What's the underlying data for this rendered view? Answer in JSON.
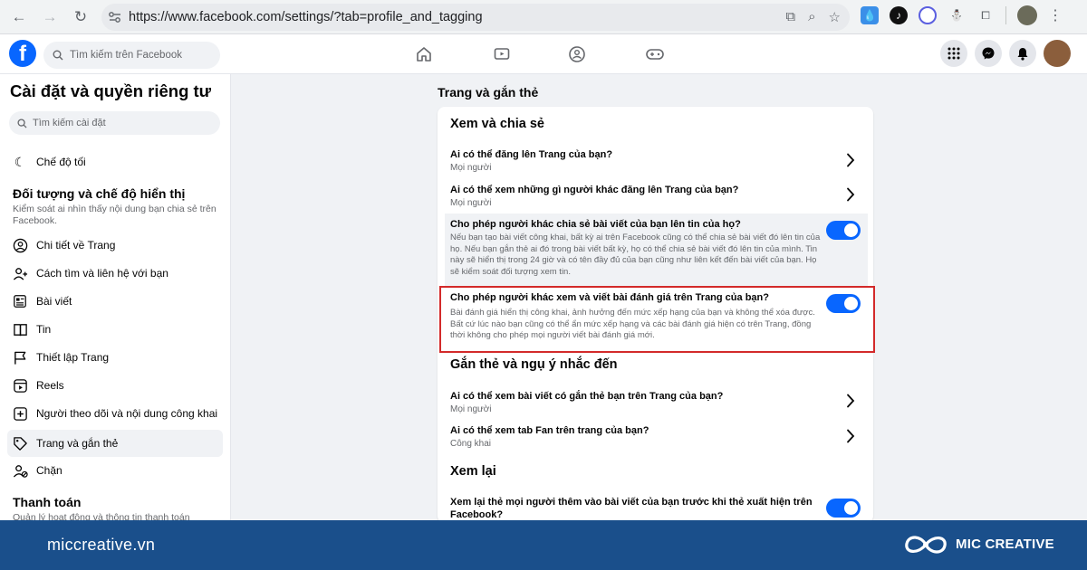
{
  "browser": {
    "url": "https://www.facebook.com/settings/?tab=profile_and_tagging"
  },
  "fb_header": {
    "logo_letter": "f",
    "search_placeholder": "Tìm kiếm trên Facebook"
  },
  "sidebar": {
    "title": "Cài đặt và quyền riêng tư",
    "search_placeholder": "Tìm kiếm cài đặt",
    "dark_mode_label": "Chế độ tối",
    "section_audience": {
      "heading": "Đối tượng và chế độ hiển thị",
      "description": "Kiểm soát ai nhìn thấy nội dung bạn chia sẻ trên Facebook."
    },
    "items": [
      {
        "label": "Chi tiết về Trang",
        "icon": "user-circle-icon"
      },
      {
        "label": "Cách tìm và liên hệ với bạn",
        "icon": "user-plus-icon"
      },
      {
        "label": "Bài viết",
        "icon": "post-icon"
      },
      {
        "label": "Tin",
        "icon": "book-open-icon"
      },
      {
        "label": "Thiết lập Trang",
        "icon": "flag-icon"
      },
      {
        "label": "Reels",
        "icon": "reels-icon"
      },
      {
        "label": "Người theo dõi và nội dung công khai",
        "icon": "plus-square-icon"
      },
      {
        "label": "Trang và gắn thẻ",
        "icon": "tag-icon",
        "active": true
      },
      {
        "label": "Chặn",
        "icon": "block-user-icon"
      }
    ],
    "section_payment": {
      "heading": "Thanh toán",
      "description": "Quản lý hoạt động và thông tin thanh toán"
    }
  },
  "main": {
    "title": "Trang và gắn thẻ",
    "sections": [
      {
        "heading": "Xem và chia sẻ",
        "rows": [
          {
            "title": "Ai có thể đăng lên Trang của bạn?",
            "value": "Mọi người",
            "control": "chevron"
          },
          {
            "title": "Ai có thể xem những gì người khác đăng lên Trang của bạn?",
            "value": "Mọi người",
            "control": "chevron"
          },
          {
            "title": "Cho phép người khác chia sẻ bài viết của bạn lên tin của họ?",
            "description": "Nếu bạn tạo bài viết công khai, bất kỳ ai trên Facebook cũng có thể chia sẻ bài viết đó lên tin của họ. Nếu bạn gắn thẻ ai đó trong bài viết bất kỳ, họ có thể chia sẻ bài viết đó lên tin của mình. Tin này sẽ hiển thị trong 24 giờ và có tên đầy đủ của bạn cũng như liên kết đến bài viết của bạn. Họ sẽ kiểm soát đối tượng xem tin.",
            "control": "toggle",
            "on": true
          },
          {
            "title": "Cho phép người khác xem và viết bài đánh giá trên Trang của bạn?",
            "description": "Bài đánh giá hiển thị công khai, ảnh hưởng đến mức xếp hạng của bạn và không thể xóa được. Bất cứ lúc nào bạn cũng có thể ẩn mức xếp hạng và các bài đánh giá hiện có trên Trang, đồng thời không cho phép mọi người viết bài đánh giá mới.",
            "control": "toggle",
            "on": true
          }
        ]
      },
      {
        "heading": "Gắn thẻ và ngụ ý nhắc đến",
        "rows": [
          {
            "title": "Ai có thể xem bài viết có gắn thẻ bạn trên Trang của bạn?",
            "value": "Mọi người",
            "control": "chevron"
          },
          {
            "title": "Ai có thể xem tab Fan trên trang của bạn?",
            "value": "Công khai",
            "control": "chevron"
          }
        ]
      },
      {
        "heading": "Xem lại",
        "rows": [
          {
            "title": "Xem lại thẻ mọi người thêm vào bài viết của bạn trước khi thẻ xuất hiện trên Facebook?",
            "control": "toggle",
            "on": true
          }
        ]
      }
    ]
  },
  "footer": {
    "site": "miccreative.vn",
    "brand": "MIC CREATIVE"
  },
  "colors": {
    "accent": "#0866ff",
    "highlight_border": "#d32a2a",
    "footer_bg": "#1a4f8b"
  }
}
